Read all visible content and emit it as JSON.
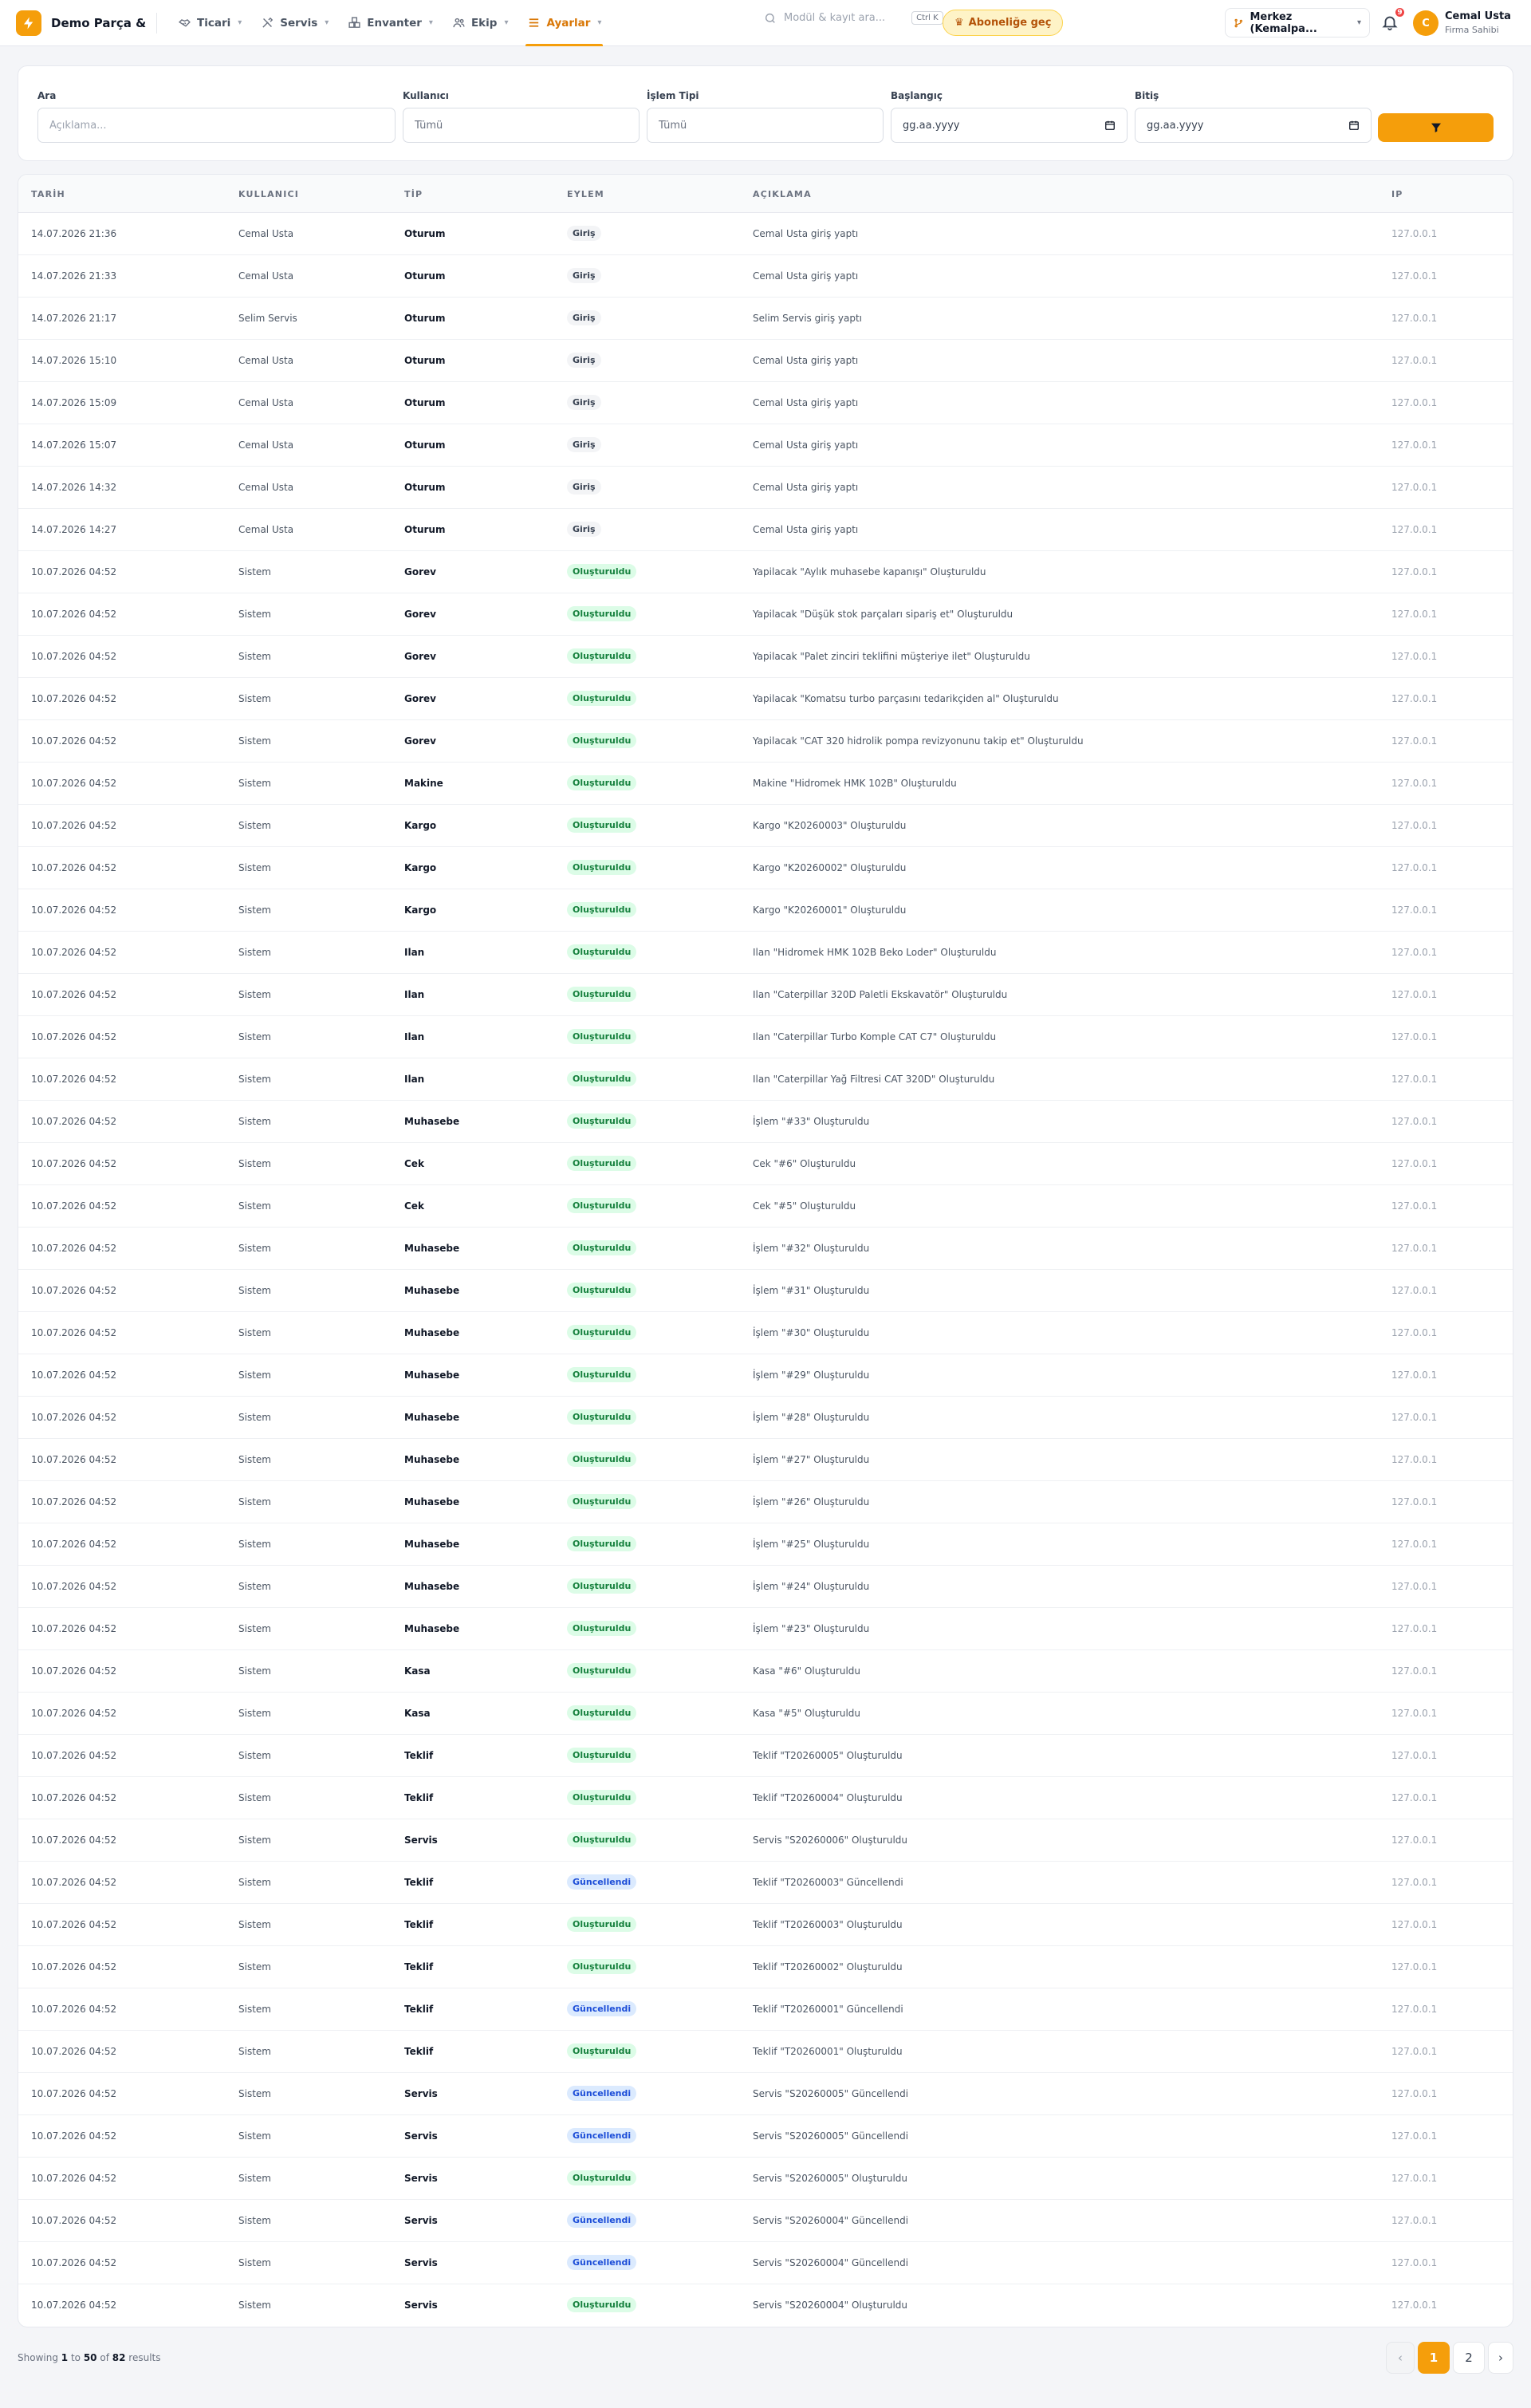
{
  "app": {
    "brand": "Demo Parça & ...",
    "logo_icon": "bolt-icon",
    "accent_color": "#f59e0b"
  },
  "nav": [
    {
      "label": "Ticari",
      "icon": "handshake-icon",
      "active": false
    },
    {
      "label": "Servis",
      "icon": "tools-icon",
      "active": false
    },
    {
      "label": "Envanter",
      "icon": "boxes-icon",
      "active": false
    },
    {
      "label": "Ekip",
      "icon": "users-icon",
      "active": false
    },
    {
      "label": "Ayarlar",
      "icon": "menu-icon",
      "active": true
    }
  ],
  "search": {
    "placeholder": "Modül & kayıt ara...",
    "shortcut": "Ctrl K"
  },
  "subscribe": {
    "label": "Aboneliğe geç",
    "icon": "crown-icon"
  },
  "branch": {
    "label": "Merkez (Kemalpa...",
    "icon": "branch-icon"
  },
  "notifications": {
    "count": "9"
  },
  "user": {
    "initial": "C",
    "name": "Cemal Usta",
    "role": "Firma Sahibi"
  },
  "filters": {
    "search": {
      "label": "Ara",
      "placeholder": "Açıklama..."
    },
    "user": {
      "label": "Kullanıcı",
      "value": "Tümü"
    },
    "type": {
      "label": "İşlem Tipi",
      "value": "Tümü"
    },
    "start": {
      "label": "Başlangıç",
      "placeholder": "gg.aa.yyyy"
    },
    "end": {
      "label": "Bitiş",
      "placeholder": "gg.aa.yyyy"
    },
    "button_icon": "filter-icon"
  },
  "table": {
    "columns": [
      "TARİH",
      "KULLANICI",
      "TİP",
      "EYLEM",
      "AÇIKLAMA",
      "IP"
    ],
    "rows": [
      [
        "14.07.2026 21:36",
        "Cemal Usta",
        "Oturum",
        "Giriş",
        "Cemal Usta giriş yaptı",
        "127.0.0.1"
      ],
      [
        "14.07.2026 21:33",
        "Cemal Usta",
        "Oturum",
        "Giriş",
        "Cemal Usta giriş yaptı",
        "127.0.0.1"
      ],
      [
        "14.07.2026 21:17",
        "Selim Servis",
        "Oturum",
        "Giriş",
        "Selim Servis giriş yaptı",
        "127.0.0.1"
      ],
      [
        "14.07.2026 15:10",
        "Cemal Usta",
        "Oturum",
        "Giriş",
        "Cemal Usta giriş yaptı",
        "127.0.0.1"
      ],
      [
        "14.07.2026 15:09",
        "Cemal Usta",
        "Oturum",
        "Giriş",
        "Cemal Usta giriş yaptı",
        "127.0.0.1"
      ],
      [
        "14.07.2026 15:07",
        "Cemal Usta",
        "Oturum",
        "Giriş",
        "Cemal Usta giriş yaptı",
        "127.0.0.1"
      ],
      [
        "14.07.2026 14:32",
        "Cemal Usta",
        "Oturum",
        "Giriş",
        "Cemal Usta giriş yaptı",
        "127.0.0.1"
      ],
      [
        "14.07.2026 14:27",
        "Cemal Usta",
        "Oturum",
        "Giriş",
        "Cemal Usta giriş yaptı",
        "127.0.0.1"
      ],
      [
        "10.07.2026 04:52",
        "Sistem",
        "Gorev",
        "Oluşturuldu",
        "Yapilacak \"Aylık muhasebe kapanışı\" Oluşturuldu",
        "127.0.0.1"
      ],
      [
        "10.07.2026 04:52",
        "Sistem",
        "Gorev",
        "Oluşturuldu",
        "Yapilacak \"Düşük stok parçaları sipariş et\" Oluşturuldu",
        "127.0.0.1"
      ],
      [
        "10.07.2026 04:52",
        "Sistem",
        "Gorev",
        "Oluşturuldu",
        "Yapilacak \"Palet zinciri teklifini müşteriye ilet\" Oluşturuldu",
        "127.0.0.1"
      ],
      [
        "10.07.2026 04:52",
        "Sistem",
        "Gorev",
        "Oluşturuldu",
        "Yapilacak \"Komatsu turbo parçasını tedarikçiden al\" Oluşturuldu",
        "127.0.0.1"
      ],
      [
        "10.07.2026 04:52",
        "Sistem",
        "Gorev",
        "Oluşturuldu",
        "Yapilacak \"CAT 320 hidrolik pompa revizyonunu takip et\" Oluşturuldu",
        "127.0.0.1"
      ],
      [
        "10.07.2026 04:52",
        "Sistem",
        "Makine",
        "Oluşturuldu",
        "Makine \"Hidromek HMK 102B\" Oluşturuldu",
        "127.0.0.1"
      ],
      [
        "10.07.2026 04:52",
        "Sistem",
        "Kargo",
        "Oluşturuldu",
        "Kargo \"K20260003\" Oluşturuldu",
        "127.0.0.1"
      ],
      [
        "10.07.2026 04:52",
        "Sistem",
        "Kargo",
        "Oluşturuldu",
        "Kargo \"K20260002\" Oluşturuldu",
        "127.0.0.1"
      ],
      [
        "10.07.2026 04:52",
        "Sistem",
        "Kargo",
        "Oluşturuldu",
        "Kargo \"K20260001\" Oluşturuldu",
        "127.0.0.1"
      ],
      [
        "10.07.2026 04:52",
        "Sistem",
        "Ilan",
        "Oluşturuldu",
        "Ilan \"Hidromek HMK 102B Beko Loder\" Oluşturuldu",
        "127.0.0.1"
      ],
      [
        "10.07.2026 04:52",
        "Sistem",
        "Ilan",
        "Oluşturuldu",
        "Ilan \"Caterpillar 320D Paletli Ekskavatör\" Oluşturuldu",
        "127.0.0.1"
      ],
      [
        "10.07.2026 04:52",
        "Sistem",
        "Ilan",
        "Oluşturuldu",
        "Ilan \"Caterpillar Turbo Komple CAT C7\" Oluşturuldu",
        "127.0.0.1"
      ],
      [
        "10.07.2026 04:52",
        "Sistem",
        "Ilan",
        "Oluşturuldu",
        "Ilan \"Caterpillar Yağ Filtresi CAT 320D\" Oluşturuldu",
        "127.0.0.1"
      ],
      [
        "10.07.2026 04:52",
        "Sistem",
        "Muhasebe",
        "Oluşturuldu",
        "İşlem \"#33\" Oluşturuldu",
        "127.0.0.1"
      ],
      [
        "10.07.2026 04:52",
        "Sistem",
        "Cek",
        "Oluşturuldu",
        "Cek \"#6\" Oluşturuldu",
        "127.0.0.1"
      ],
      [
        "10.07.2026 04:52",
        "Sistem",
        "Cek",
        "Oluşturuldu",
        "Cek \"#5\" Oluşturuldu",
        "127.0.0.1"
      ],
      [
        "10.07.2026 04:52",
        "Sistem",
        "Muhasebe",
        "Oluşturuldu",
        "İşlem \"#32\" Oluşturuldu",
        "127.0.0.1"
      ],
      [
        "10.07.2026 04:52",
        "Sistem",
        "Muhasebe",
        "Oluşturuldu",
        "İşlem \"#31\" Oluşturuldu",
        "127.0.0.1"
      ],
      [
        "10.07.2026 04:52",
        "Sistem",
        "Muhasebe",
        "Oluşturuldu",
        "İşlem \"#30\" Oluşturuldu",
        "127.0.0.1"
      ],
      [
        "10.07.2026 04:52",
        "Sistem",
        "Muhasebe",
        "Oluşturuldu",
        "İşlem \"#29\" Oluşturuldu",
        "127.0.0.1"
      ],
      [
        "10.07.2026 04:52",
        "Sistem",
        "Muhasebe",
        "Oluşturuldu",
        "İşlem \"#28\" Oluşturuldu",
        "127.0.0.1"
      ],
      [
        "10.07.2026 04:52",
        "Sistem",
        "Muhasebe",
        "Oluşturuldu",
        "İşlem \"#27\" Oluşturuldu",
        "127.0.0.1"
      ],
      [
        "10.07.2026 04:52",
        "Sistem",
        "Muhasebe",
        "Oluşturuldu",
        "İşlem \"#26\" Oluşturuldu",
        "127.0.0.1"
      ],
      [
        "10.07.2026 04:52",
        "Sistem",
        "Muhasebe",
        "Oluşturuldu",
        "İşlem \"#25\" Oluşturuldu",
        "127.0.0.1"
      ],
      [
        "10.07.2026 04:52",
        "Sistem",
        "Muhasebe",
        "Oluşturuldu",
        "İşlem \"#24\" Oluşturuldu",
        "127.0.0.1"
      ],
      [
        "10.07.2026 04:52",
        "Sistem",
        "Muhasebe",
        "Oluşturuldu",
        "İşlem \"#23\" Oluşturuldu",
        "127.0.0.1"
      ],
      [
        "10.07.2026 04:52",
        "Sistem",
        "Kasa",
        "Oluşturuldu",
        "Kasa \"#6\" Oluşturuldu",
        "127.0.0.1"
      ],
      [
        "10.07.2026 04:52",
        "Sistem",
        "Kasa",
        "Oluşturuldu",
        "Kasa \"#5\" Oluşturuldu",
        "127.0.0.1"
      ],
      [
        "10.07.2026 04:52",
        "Sistem",
        "Teklif",
        "Oluşturuldu",
        "Teklif \"T20260005\" Oluşturuldu",
        "127.0.0.1"
      ],
      [
        "10.07.2026 04:52",
        "Sistem",
        "Teklif",
        "Oluşturuldu",
        "Teklif \"T20260004\" Oluşturuldu",
        "127.0.0.1"
      ],
      [
        "10.07.2026 04:52",
        "Sistem",
        "Servis",
        "Oluşturuldu",
        "Servis \"S20260006\" Oluşturuldu",
        "127.0.0.1"
      ],
      [
        "10.07.2026 04:52",
        "Sistem",
        "Teklif",
        "Güncellendi",
        "Teklif \"T20260003\" Güncellendi",
        "127.0.0.1"
      ],
      [
        "10.07.2026 04:52",
        "Sistem",
        "Teklif",
        "Oluşturuldu",
        "Teklif \"T20260003\" Oluşturuldu",
        "127.0.0.1"
      ],
      [
        "10.07.2026 04:52",
        "Sistem",
        "Teklif",
        "Oluşturuldu",
        "Teklif \"T20260002\" Oluşturuldu",
        "127.0.0.1"
      ],
      [
        "10.07.2026 04:52",
        "Sistem",
        "Teklif",
        "Güncellendi",
        "Teklif \"T20260001\" Güncellendi",
        "127.0.0.1"
      ],
      [
        "10.07.2026 04:52",
        "Sistem",
        "Teklif",
        "Oluşturuldu",
        "Teklif \"T20260001\" Oluşturuldu",
        "127.0.0.1"
      ],
      [
        "10.07.2026 04:52",
        "Sistem",
        "Servis",
        "Güncellendi",
        "Servis \"S20260005\" Güncellendi",
        "127.0.0.1"
      ],
      [
        "10.07.2026 04:52",
        "Sistem",
        "Servis",
        "Güncellendi",
        "Servis \"S20260005\" Güncellendi",
        "127.0.0.1"
      ],
      [
        "10.07.2026 04:52",
        "Sistem",
        "Servis",
        "Oluşturuldu",
        "Servis \"S20260005\" Oluşturuldu",
        "127.0.0.1"
      ],
      [
        "10.07.2026 04:52",
        "Sistem",
        "Servis",
        "Güncellendi",
        "Servis \"S20260004\" Güncellendi",
        "127.0.0.1"
      ],
      [
        "10.07.2026 04:52",
        "Sistem",
        "Servis",
        "Güncellendi",
        "Servis \"S20260004\" Güncellendi",
        "127.0.0.1"
      ],
      [
        "10.07.2026 04:52",
        "Sistem",
        "Servis",
        "Oluşturuldu",
        "Servis \"S20260004\" Oluşturuldu",
        "127.0.0.1"
      ]
    ]
  },
  "footer": {
    "showing_prefix": "Showing",
    "from": "1",
    "to_word": "to",
    "to": "50",
    "of_word": "of",
    "total": "82",
    "results_word": "results"
  },
  "pagination": {
    "prev": "‹",
    "pages": [
      "1",
      "2"
    ],
    "current": "1",
    "next": "›"
  }
}
